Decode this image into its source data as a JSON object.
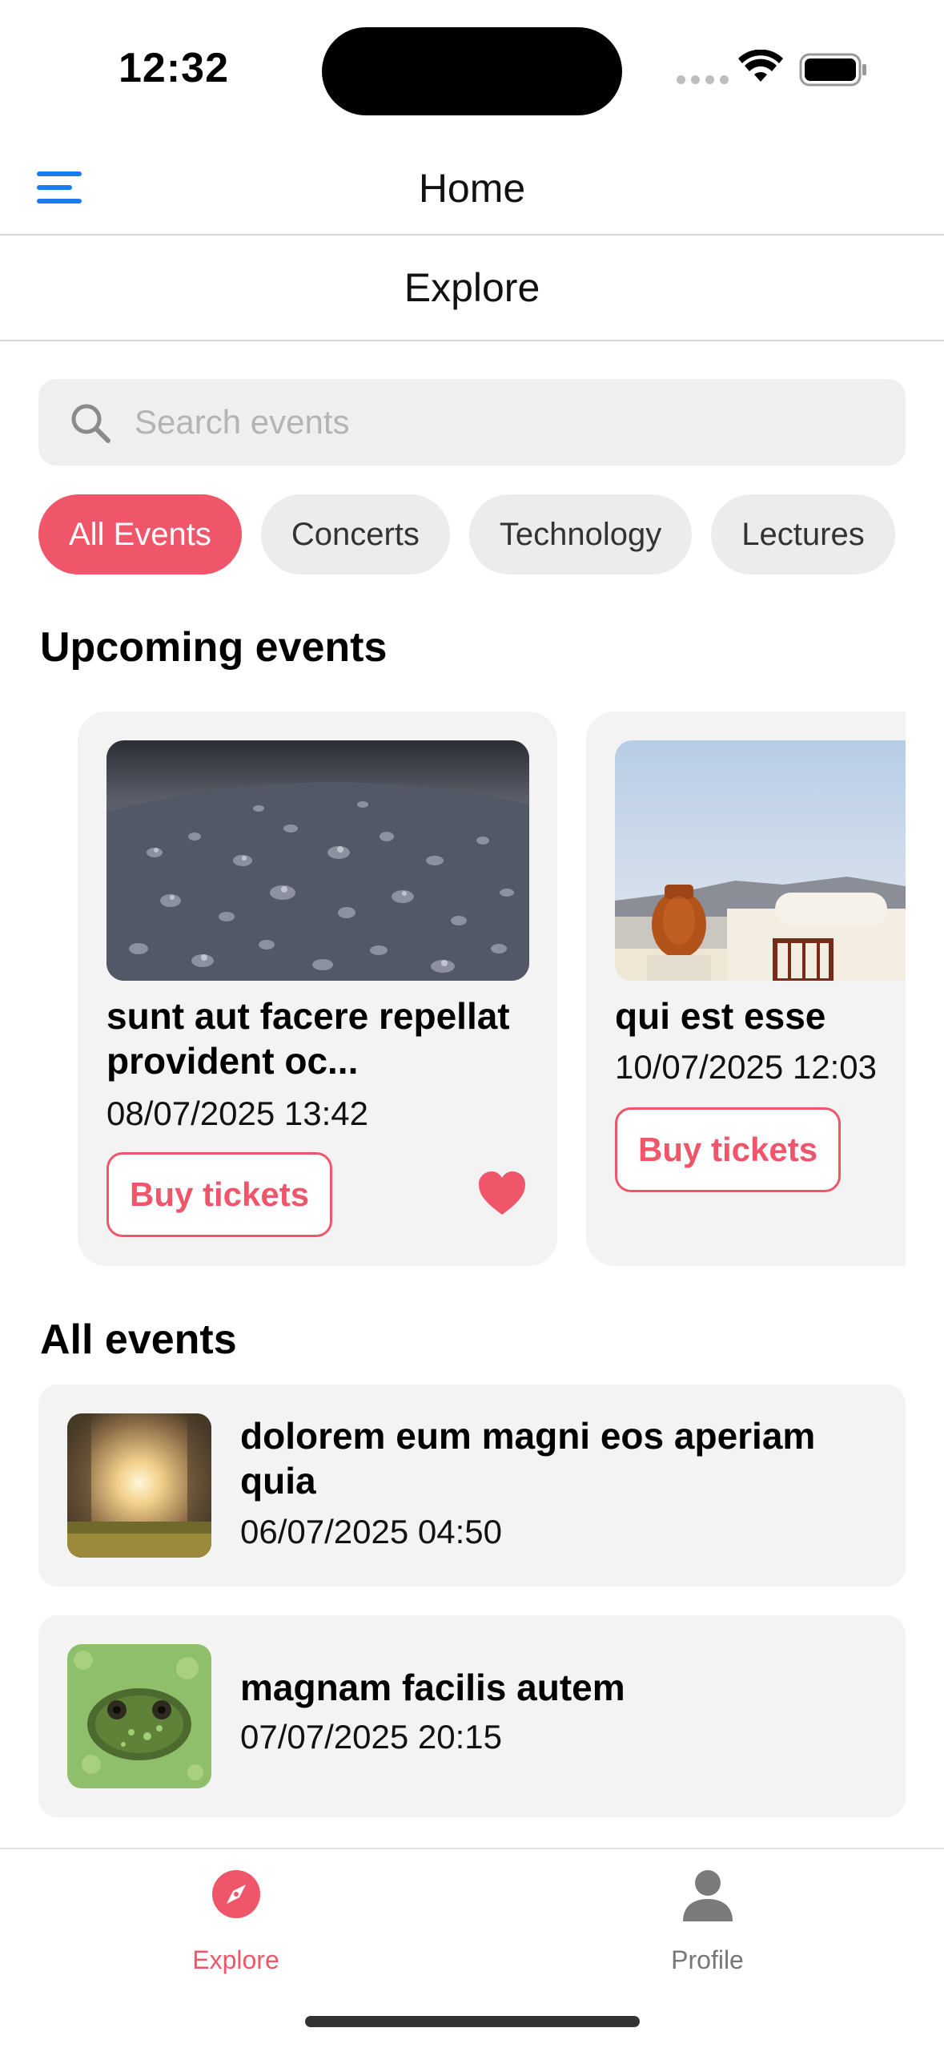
{
  "status_bar": {
    "time": "12:32"
  },
  "header": {
    "title": "Home",
    "menu_icon": "hamburger-menu-icon"
  },
  "sub_header": {
    "title": "Explore"
  },
  "search": {
    "placeholder": "Search events",
    "value": ""
  },
  "categories": [
    {
      "label": "All Events",
      "active": true
    },
    {
      "label": "Concerts",
      "active": false
    },
    {
      "label": "Technology",
      "active": false
    },
    {
      "label": "Lectures",
      "active": false
    }
  ],
  "upcoming": {
    "title": "Upcoming events",
    "events": [
      {
        "title": "sunt aut facere repellat provident oc...",
        "date": "08/07/2025 13:42",
        "buy_label": "Buy tickets",
        "favorite": true
      },
      {
        "title": "qui est esse",
        "date": "10/07/2025 12:03",
        "buy_label": "Buy tickets",
        "favorite": false
      }
    ]
  },
  "all_events": {
    "title": "All events",
    "items": [
      {
        "title": "dolorem eum magni eos aperiam quia",
        "date": "06/07/2025 04:50"
      },
      {
        "title": "magnam facilis autem",
        "date": "07/07/2025 20:15"
      }
    ]
  },
  "tab_bar": {
    "tabs": [
      {
        "label": "Explore",
        "icon": "compass-icon",
        "active": true
      },
      {
        "label": "Profile",
        "icon": "person-icon",
        "active": false
      }
    ]
  },
  "colors": {
    "accent": "#f0566a",
    "link": "#1a7cf0",
    "card_bg": "#f3f3f3"
  }
}
